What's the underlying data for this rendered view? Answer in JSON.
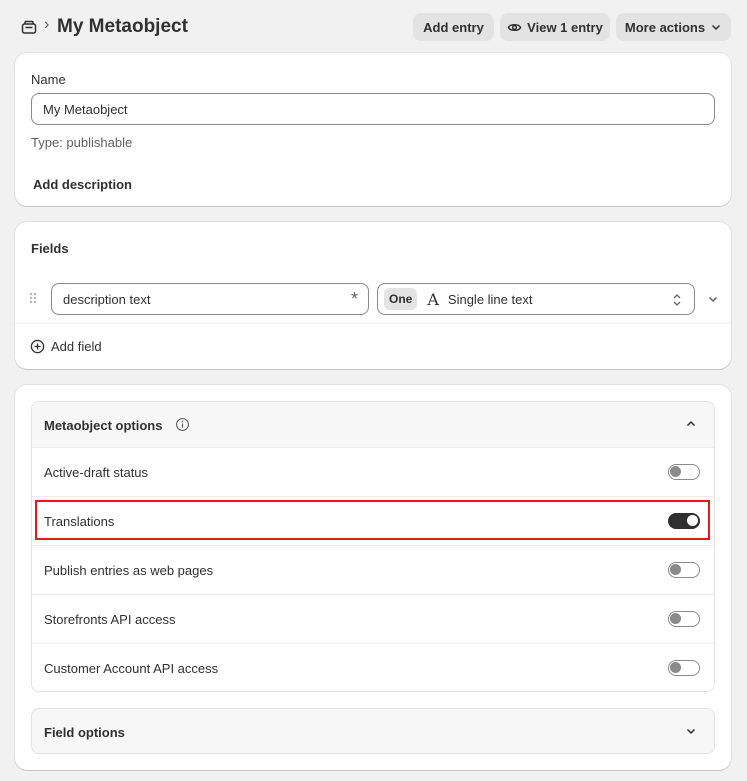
{
  "header": {
    "breadcrumb_icon": "metaobject-icon",
    "separator": "›",
    "title": "My Metaobject",
    "add_entry": "Add entry",
    "view_entry": "View 1 entry",
    "more_actions": "More actions"
  },
  "name_card": {
    "label": "Name",
    "value": "My Metaobject",
    "type_text": "Type: publishable",
    "add_description": "Add description"
  },
  "fields_card": {
    "title": "Fields",
    "field": {
      "name": "description text",
      "required_marker": "*",
      "cardinality": "One",
      "type_glyph": "A",
      "type_label": "Single line text"
    },
    "add_field": "Add field"
  },
  "options_card": {
    "title": "Metaobject options",
    "options": [
      {
        "label": "Active-draft status",
        "enabled": false
      },
      {
        "label": "Translations",
        "enabled": true
      },
      {
        "label": "Publish entries as web pages",
        "enabled": false
      },
      {
        "label": "Storefronts API access",
        "enabled": false
      },
      {
        "label": "Customer Account API access",
        "enabled": false
      }
    ],
    "field_options_title": "Field options"
  },
  "colors": {
    "highlight": "#e01b1b",
    "toggle_on": "#303030",
    "toggle_off": "#8a8a8a"
  }
}
